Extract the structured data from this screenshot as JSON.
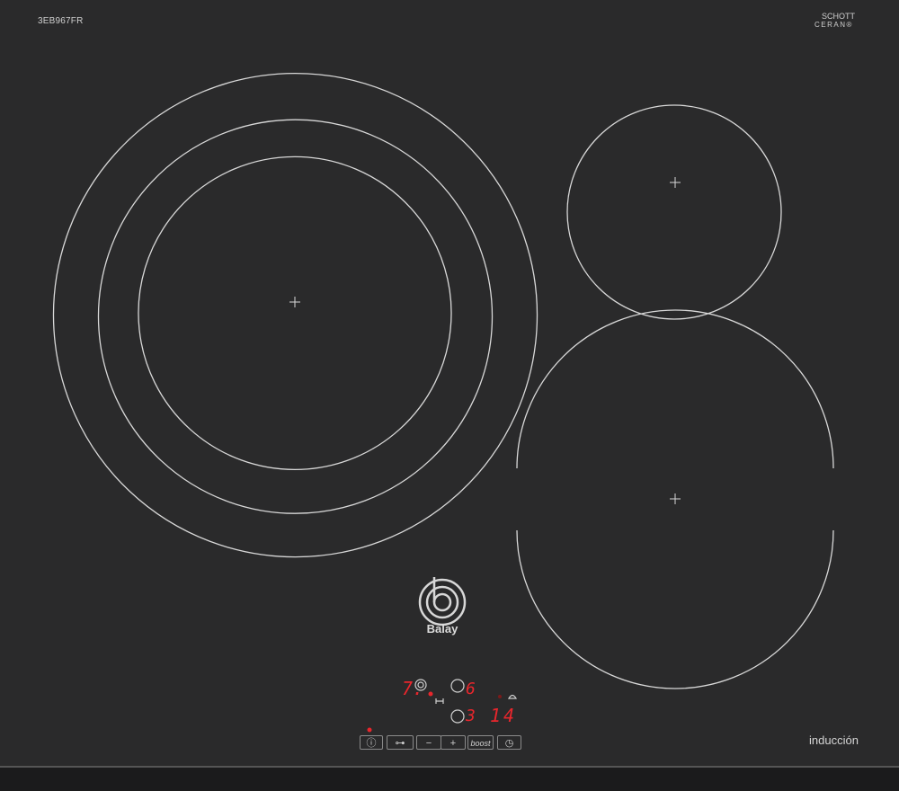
{
  "model_code": "3EB967FR",
  "glass_brand": {
    "name": "SCHOTT",
    "sub": "CERAN®",
    "fine_print": ""
  },
  "appliance_brand": "Balay",
  "type_label": "inducción",
  "displays": {
    "zone_1_level": "7.",
    "zone_2_level": "6",
    "zone_3_level": "3",
    "timer": "14"
  },
  "controls": {
    "info": "ⓘ",
    "lock": "⊶",
    "minus": "−",
    "plus": "+",
    "boost": "boost",
    "timer": "◷"
  },
  "colors": {
    "glass": "#2a2a2b",
    "ring": "#d8d8d8",
    "display_red": "#e8262c"
  }
}
